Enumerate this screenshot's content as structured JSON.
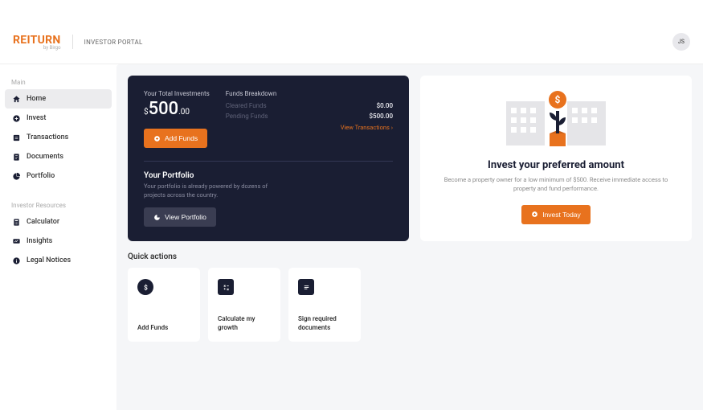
{
  "header": {
    "logo": "REITURN",
    "logo_sub": "by Birgo",
    "portal_label": "INVESTOR PORTAL",
    "avatar_initials": "JS"
  },
  "sidebar": {
    "main_label": "Main",
    "resources_label": "Investor Resources",
    "main_items": [
      {
        "label": "Home"
      },
      {
        "label": "Invest"
      },
      {
        "label": "Transactions"
      },
      {
        "label": "Documents"
      },
      {
        "label": "Portfolio"
      }
    ],
    "resource_items": [
      {
        "label": "Calculator"
      },
      {
        "label": "Insights"
      },
      {
        "label": "Legal Notices"
      }
    ]
  },
  "investments": {
    "total_label": "Your Total Investments",
    "currency": "$",
    "amount_int": "500",
    "amount_dec": ".00",
    "add_funds_label": "Add Funds",
    "breakdown_title": "Funds Breakdown",
    "cleared_label": "Cleared Funds",
    "cleared_value": "$0.00",
    "pending_label": "Pending Funds",
    "pending_value": "$500.00",
    "view_transactions": "View Transactions  ›",
    "portfolio_title": "Your Portfolio",
    "portfolio_desc": "Your portfolio is already powered by dozens of projects across the country.",
    "view_portfolio_label": "View Portfolio"
  },
  "cta": {
    "title": "Invest your preferred amount",
    "desc": "Become a property owner for a low minimum of $500. Receive immediate access to property and fund performance.",
    "button": "Invest Today"
  },
  "quick": {
    "title": "Quick actions",
    "items": [
      {
        "label": "Add Funds"
      },
      {
        "label": "Calculate my growth"
      },
      {
        "label": "Sign required documents"
      }
    ]
  }
}
